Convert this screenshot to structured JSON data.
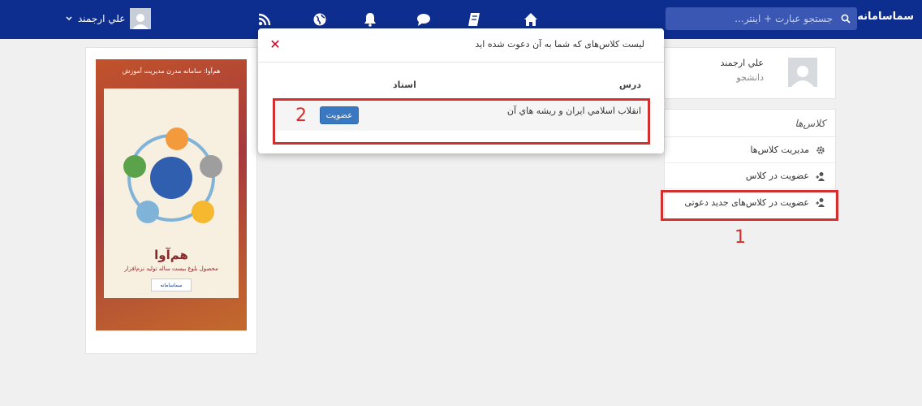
{
  "navbar": {
    "brand": "سماسامانه",
    "search_placeholder": "جستجو عبارت + اينتر...",
    "user_name": "علي ارجمند",
    "icons": [
      "rss-icon",
      "globe-icon",
      "bell-icon",
      "chat-icon",
      "book-icon",
      "home-icon"
    ]
  },
  "profile": {
    "name": "علي ارجمند",
    "role": "دانشجو"
  },
  "classes_panel": {
    "title": "كلاس‌ها",
    "items": [
      {
        "label": "مدیریت کلاس‌ها",
        "icon": "gear-icon"
      },
      {
        "label": "عضویت در کلاس",
        "icon": "user-plus-icon"
      },
      {
        "label": "عضویت در کلاس‌های جدید دعوتی",
        "icon": "user-plus-icon"
      }
    ]
  },
  "annotations": {
    "step1": "1",
    "step2": "2",
    "color": "#d32f2f"
  },
  "modal": {
    "title": "لیست کلاس‌های که شما به آن دعوت شده اید",
    "col_course": "درس",
    "col_teacher": "استاد",
    "course_name": "انقلاب اسلامي ايران و ريشه هاي آن",
    "join_label": "عضویت"
  },
  "poster": {
    "header": "هم‌آوا: سامانه مدرن مدیریت آموزش",
    "title": "هم‌آوا",
    "subtitle": "محصول بلوغ بیست ساله تولید نرم‌افزار",
    "logo": "سماسامانه"
  },
  "colors": {
    "navbar": "#0e2e8f",
    "button": "#3a78c2",
    "highlight": "#d32f2f"
  }
}
